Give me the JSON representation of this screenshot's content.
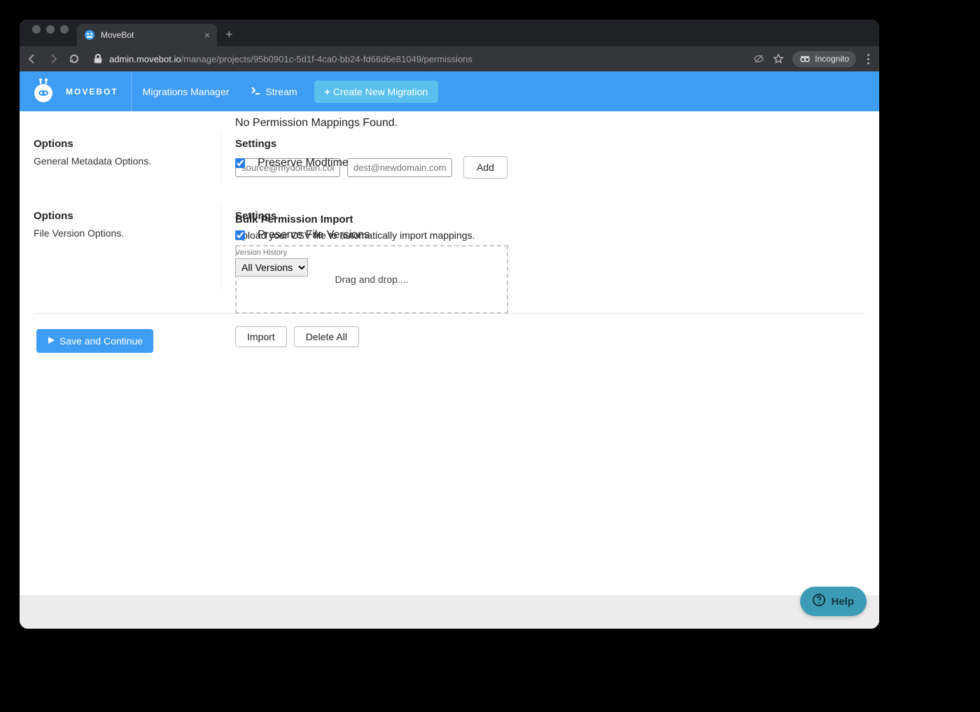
{
  "browser": {
    "tab_title": "MoveBot",
    "url_domain": "admin.movebot.io",
    "url_path": "/manage/projects/95b0901c-5d1f-4ca0-bb24-fd66d6e81049/permissions",
    "incognito_label": "Incognito"
  },
  "nav": {
    "brand": "MOVEBOT",
    "migrations_manager": "Migrations Manager",
    "stream": "Stream",
    "create_new": "Create New Migration"
  },
  "permissions": {
    "empty_msg": "No Permission Mappings Found.",
    "source_placeholder": "source@mydomain.com",
    "dest_placeholder": "dest@newdomain.com",
    "add_label": "Add",
    "bulk_heading": "Bulk Permission Import",
    "bulk_sub": "Upload your CSV file to automatically import mappings.",
    "drop_text": "Drag and drop....",
    "import_label": "Import",
    "delete_all_label": "Delete All"
  },
  "metadata": {
    "left_heading": "Options",
    "left_sub": "General Metadata Options.",
    "right_heading": "Settings",
    "preserve_modtime_label": "Preserve Modtime",
    "preserve_modtime_checked": true
  },
  "versions": {
    "left_heading": "Options",
    "left_sub": "File Version Options.",
    "right_heading": "Settings",
    "preserve_versions_label": "Preserve File Versions",
    "preserve_versions_checked": true,
    "history_label": "Version History",
    "history_selected": "All Versions"
  },
  "footer": {
    "save_label": "Save and Continue",
    "help_label": "Help"
  }
}
